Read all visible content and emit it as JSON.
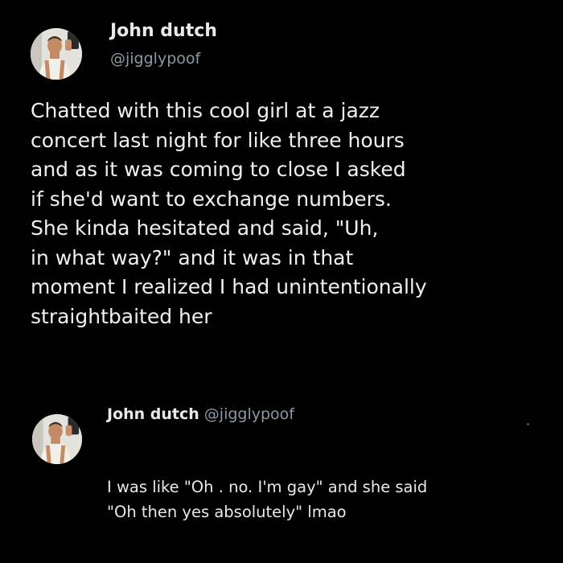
{
  "main_tweet": {
    "author": {
      "display_name": "John dutch",
      "handle": "@jigglypoof",
      "avatar_icon": "profile-photo-icon"
    },
    "text": "Chatted with this cool girl at a jazz\nconcert last night for like three hours\nand as it was coming to close I asked\nif she'd want to exchange numbers.\nShe kinda hesitated and said, \"Uh,\nin what way?\" and it was in that\nmoment I realized I had unintentionally\nstraightbaited her"
  },
  "reply_tweet": {
    "author": {
      "display_name": "John dutch",
      "handle": "@jigglypoof",
      "avatar_icon": "profile-photo-icon"
    },
    "text": "I was like \"Oh . no. I'm gay\" and she said\n\"Oh then yes absolutely\" lmao"
  },
  "colors": {
    "background": "#000000",
    "primary_text": "#e7e9ea",
    "secondary_text": "#8b98a5"
  }
}
